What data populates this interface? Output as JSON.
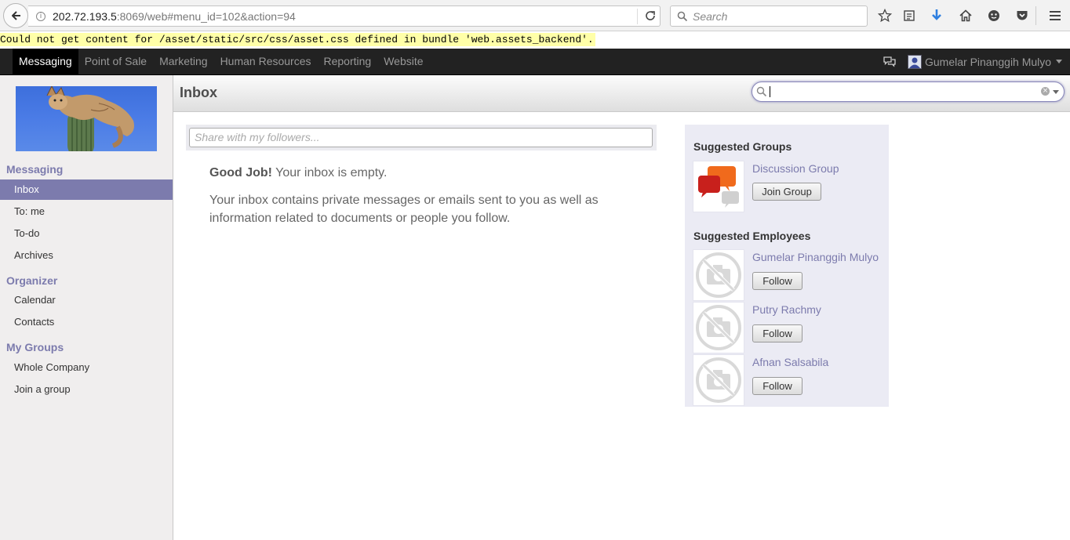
{
  "browser": {
    "url_host": "202.72.193.5",
    "url_path": ":8069/web#menu_id=102&action=94",
    "search_placeholder": "Search"
  },
  "warning": "Could not get content for /asset/static/src/css/asset.css defined in bundle 'web.assets_backend'.",
  "topnav": {
    "menu": [
      "Messaging",
      "Point of Sale",
      "Marketing",
      "Human Resources",
      "Reporting",
      "Website"
    ],
    "active": "Messaging",
    "user_name": "Gumelar Pinanggih Mulyo"
  },
  "sidebar": {
    "sections": [
      {
        "title": "Messaging",
        "items": [
          "Inbox",
          "To: me",
          "To-do",
          "Archives"
        ]
      },
      {
        "title": "Organizer",
        "items": [
          "Calendar",
          "Contacts"
        ]
      },
      {
        "title": "My Groups",
        "items": [
          "Whole Company",
          "Join a group"
        ]
      }
    ],
    "active_item": "Inbox"
  },
  "main": {
    "title": "Inbox",
    "share_placeholder": "Share with my followers...",
    "empty_strong": "Good Job!",
    "empty_rest": " Your inbox is empty.",
    "empty_text": "Your inbox contains private messages or emails sent to you as well as information related to documents or people you follow."
  },
  "suggested_groups": {
    "title": "Suggested Groups",
    "groups": [
      {
        "name": "Discussion Group",
        "button": "Join Group"
      }
    ]
  },
  "suggested_employees": {
    "title": "Suggested Employees",
    "employees": [
      {
        "name": "Gumelar Pinanggih Mulyo",
        "button": "Follow"
      },
      {
        "name": "Putry Rachmy",
        "button": "Follow"
      },
      {
        "name": "Afnan Salsabila",
        "button": "Follow"
      }
    ]
  },
  "colors": {
    "accent": "#7c7bad",
    "topbar": "#222222",
    "warning_bg": "#ffffa8"
  }
}
